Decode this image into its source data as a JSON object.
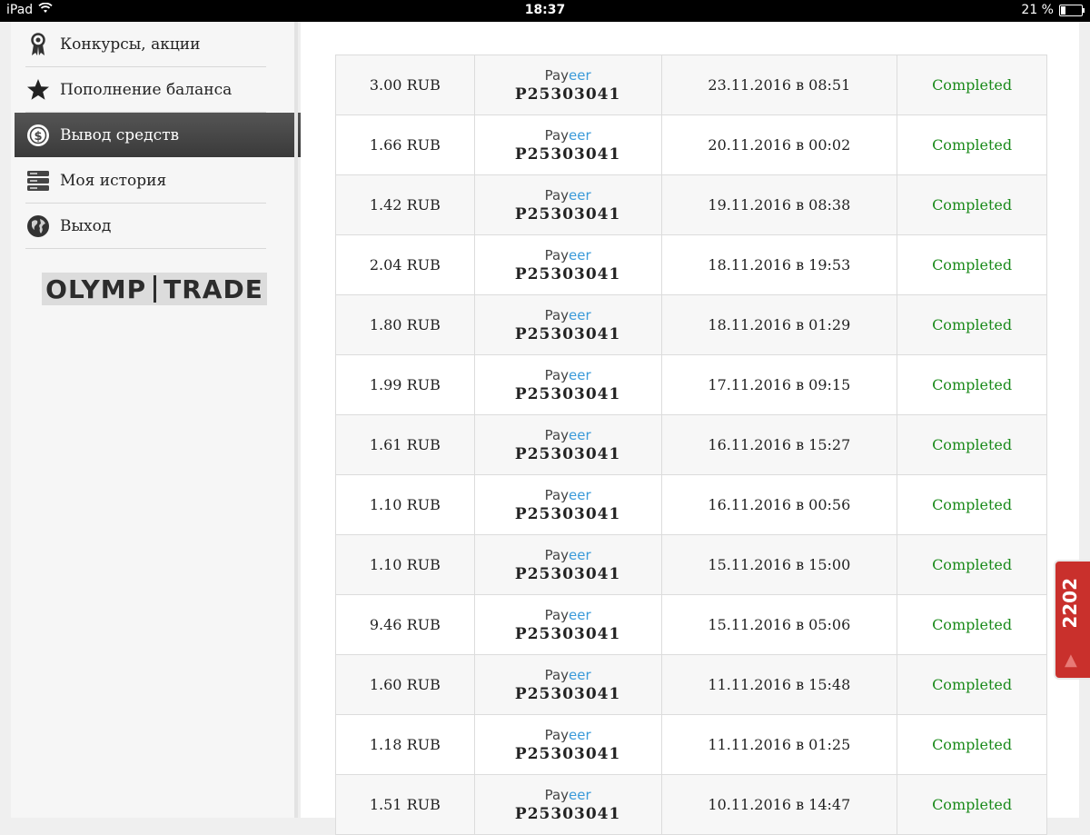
{
  "statusbar": {
    "device": "iPad",
    "time": "18:37",
    "battery": "21 %",
    "battery_level": 0.21
  },
  "sidebar": {
    "items": [
      {
        "label": "Конкурсы, акции",
        "icon": "award-ribbon-icon",
        "active": false
      },
      {
        "label": "Пополнение баланса",
        "icon": "star-icon",
        "active": false
      },
      {
        "label": "Вывод средств",
        "icon": "dollar-coin-icon",
        "active": true
      },
      {
        "label": "Моя история",
        "icon": "server-stack-icon",
        "active": false
      },
      {
        "label": "Выход",
        "icon": "globe-icon",
        "active": false
      }
    ],
    "logo": {
      "left": "OLYMP",
      "right": "TRADE"
    }
  },
  "transactions": {
    "payment_system": {
      "part1": "Pay",
      "part2": "eer"
    },
    "rows": [
      {
        "amount": "3.00 RUB",
        "account": "P25303041",
        "date": "23.11.2016 в 08:51",
        "status": "Completed"
      },
      {
        "amount": "1.66 RUB",
        "account": "P25303041",
        "date": "20.11.2016 в 00:02",
        "status": "Completed"
      },
      {
        "amount": "1.42 RUB",
        "account": "P25303041",
        "date": "19.11.2016 в 08:38",
        "status": "Completed"
      },
      {
        "amount": "2.04 RUB",
        "account": "P25303041",
        "date": "18.11.2016 в 19:53",
        "status": "Completed"
      },
      {
        "amount": "1.80 RUB",
        "account": "P25303041",
        "date": "18.11.2016 в 01:29",
        "status": "Completed"
      },
      {
        "amount": "1.99 RUB",
        "account": "P25303041",
        "date": "17.11.2016 в 09:15",
        "status": "Completed"
      },
      {
        "amount": "1.61 RUB",
        "account": "P25303041",
        "date": "16.11.2016 в 15:27",
        "status": "Completed"
      },
      {
        "amount": "1.10 RUB",
        "account": "P25303041",
        "date": "16.11.2016 в 00:56",
        "status": "Completed"
      },
      {
        "amount": "1.10 RUB",
        "account": "P25303041",
        "date": "15.11.2016 в 15:00",
        "status": "Completed"
      },
      {
        "amount": "9.46 RUB",
        "account": "P25303041",
        "date": "15.11.2016 в 05:06",
        "status": "Completed"
      },
      {
        "amount": "1.60 RUB",
        "account": "P25303041",
        "date": "11.11.2016 в 15:48",
        "status": "Completed"
      },
      {
        "amount": "1.18 RUB",
        "account": "P25303041",
        "date": "11.11.2016 в 01:25",
        "status": "Completed"
      },
      {
        "amount": "1.51 RUB",
        "account": "P25303041",
        "date": "10.11.2016 в 14:47",
        "status": "Completed"
      }
    ]
  },
  "side_badge": {
    "count": "2202"
  },
  "colors": {
    "status_completed": "#1a8a1a",
    "payeer_accent": "#3a9ad9",
    "active_menu": "#444444",
    "badge": "#c9302c"
  }
}
